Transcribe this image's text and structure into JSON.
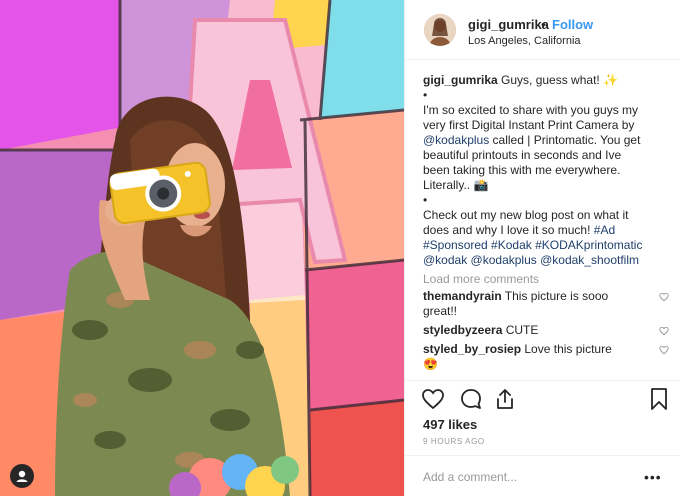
{
  "header": {
    "username": "gigi_gumrika",
    "separator": "•",
    "follow_label": "Follow",
    "location": "Los Angeles, California"
  },
  "caption": {
    "username": "gigi_gumrika",
    "line1_text": " Guys, guess what! ✨",
    "bullet": "•",
    "line2": "I'm so excited to share with you guys my",
    "line3": "very first Digital Instant Print Camera by",
    "line4_mention": "@kodakplus",
    "line4_text": " called | Printomatic. You get",
    "line5": "beautiful printouts in seconds and Ive",
    "line6": "been taking this with me everywhere.",
    "line7": "Literally.. 📸",
    "line8": "Check out my new blog post on what it",
    "line9_text": "does and why I love it so much! ",
    "line9_tag": "#Ad",
    "line10": "#Sponsored #Kodak #KODAKprintomatic",
    "line11": "@kodak @kodakplus @kodak_shootfilm"
  },
  "load_more": "Load more comments",
  "comments": [
    {
      "username": "themandyrain",
      "text": " This picture is sooo",
      "text2": "great!!"
    },
    {
      "username": "styledbyzeera",
      "text": " CUTE",
      "text2": ""
    },
    {
      "username": "styled_by_rosiep",
      "text": " Love this picture",
      "text2": "😍"
    }
  ],
  "likes": "497 likes",
  "timestamp": "9 HOURS AGO",
  "add_comment_placeholder": "Add a comment...",
  "more_label": "•••",
  "icons": {
    "like": "heart-icon",
    "comment": "comment-icon",
    "share": "share-icon",
    "save": "bookmark-icon",
    "comment_like": "heart-icon",
    "user_tag": "user-icon"
  },
  "colors": {
    "follow": "#3897f0",
    "link": "#1f3f6b",
    "muted": "#999999",
    "divider": "#efefef"
  }
}
